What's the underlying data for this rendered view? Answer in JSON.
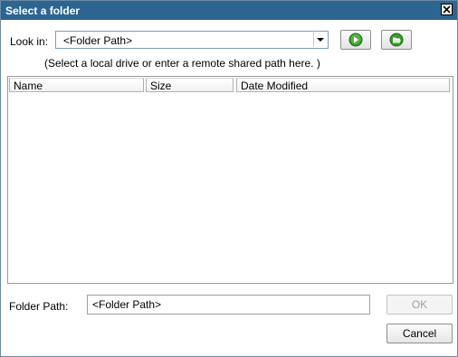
{
  "window": {
    "title": "Select a folder"
  },
  "look_in": {
    "label": "Look in:",
    "value": "<Folder Path>"
  },
  "hint": "(Select a local drive or enter a remote shared path here. )",
  "file_list": {
    "columns": [
      "Name",
      "Size",
      "Date Modified"
    ],
    "rows": []
  },
  "folder_path": {
    "label": "Folder Path:",
    "value": "<Folder Path>"
  },
  "buttons": {
    "ok": "OK",
    "cancel": "Cancel"
  },
  "icons": {
    "close": "close-icon",
    "go": "go-arrow-icon",
    "open": "open-folder-icon",
    "dropdown": "chevron-down-icon"
  },
  "colors": {
    "titlebar": "#2c6590",
    "icon_green": "#3a9a2a"
  }
}
